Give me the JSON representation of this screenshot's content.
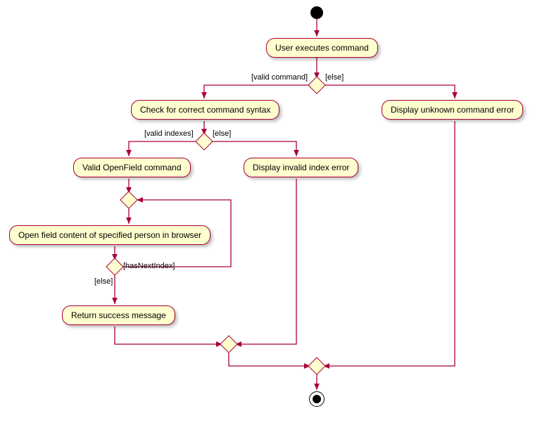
{
  "nodes": {
    "n1": "User executes command",
    "n2": "Check for correct command syntax",
    "n3": "Display unknown command error",
    "n4": "Valid OpenField command",
    "n5": "Display invalid index error",
    "n6": "Open field content of specified person in browser",
    "n7": "Return success message"
  },
  "labels": {
    "l1": "[valid command]",
    "l2": "[else]",
    "l3": "[valid indexes]",
    "l4": "[else]",
    "l5": "[hasNextIndex]",
    "l6": "[else]"
  },
  "chart_data": {
    "type": "activity-diagram",
    "title": "",
    "start": "start",
    "end": "end",
    "nodes": [
      {
        "id": "start",
        "type": "initial"
      },
      {
        "id": "n1",
        "type": "activity",
        "label": "User executes command"
      },
      {
        "id": "d1",
        "type": "decision"
      },
      {
        "id": "n2",
        "type": "activity",
        "label": "Check for correct command syntax"
      },
      {
        "id": "n3",
        "type": "activity",
        "label": "Display unknown command error"
      },
      {
        "id": "d2",
        "type": "decision"
      },
      {
        "id": "n4",
        "type": "activity",
        "label": "Valid OpenField command"
      },
      {
        "id": "n5",
        "type": "activity",
        "label": "Display invalid index error"
      },
      {
        "id": "m_loop_in",
        "type": "merge"
      },
      {
        "id": "n6",
        "type": "activity",
        "label": "Open field content of specified person in browser"
      },
      {
        "id": "d3",
        "type": "decision"
      },
      {
        "id": "n7",
        "type": "activity",
        "label": "Return success message"
      },
      {
        "id": "m1",
        "type": "merge"
      },
      {
        "id": "m2",
        "type": "merge"
      },
      {
        "id": "end",
        "type": "final"
      }
    ],
    "edges": [
      {
        "from": "start",
        "to": "n1"
      },
      {
        "from": "n1",
        "to": "d1"
      },
      {
        "from": "d1",
        "to": "n2",
        "guard": "[valid command]"
      },
      {
        "from": "d1",
        "to": "n3",
        "guard": "[else]"
      },
      {
        "from": "n2",
        "to": "d2"
      },
      {
        "from": "d2",
        "to": "n4",
        "guard": "[valid indexes]"
      },
      {
        "from": "d2",
        "to": "n5",
        "guard": "[else]"
      },
      {
        "from": "n4",
        "to": "m_loop_in"
      },
      {
        "from": "m_loop_in",
        "to": "n6"
      },
      {
        "from": "n6",
        "to": "d3"
      },
      {
        "from": "d3",
        "to": "m_loop_in",
        "guard": "[hasNextIndex]"
      },
      {
        "from": "d3",
        "to": "n7",
        "guard": "[else]"
      },
      {
        "from": "n7",
        "to": "m1"
      },
      {
        "from": "n5",
        "to": "m1"
      },
      {
        "from": "m1",
        "to": "m2"
      },
      {
        "from": "n3",
        "to": "m2"
      },
      {
        "from": "m2",
        "to": "end"
      }
    ]
  }
}
